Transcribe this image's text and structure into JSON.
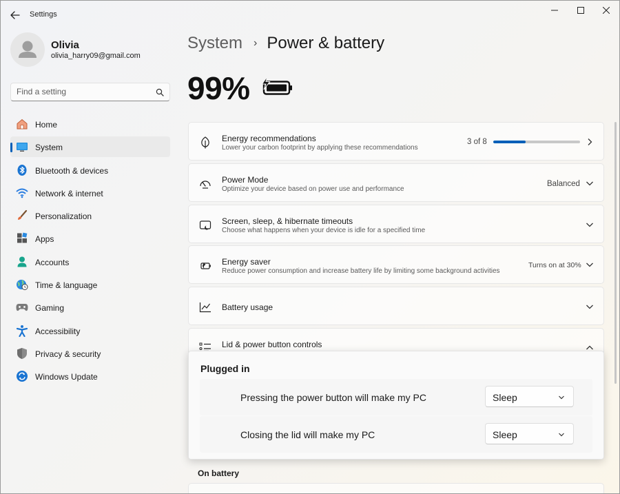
{
  "window": {
    "title": "Settings",
    "back_label": "←",
    "minimize_label": "—",
    "maximize_label": "☐",
    "close_label": "✕"
  },
  "profile": {
    "name": "Olivia",
    "email": "olivia_harry09@gmail.com"
  },
  "search": {
    "placeholder": "Find a setting",
    "value": ""
  },
  "sidebar": {
    "items": [
      {
        "label": "Home",
        "icon": "home-icon"
      },
      {
        "label": "System",
        "icon": "system-icon",
        "active": true
      },
      {
        "label": "Bluetooth & devices",
        "icon": "bluetooth-icon"
      },
      {
        "label": "Network & internet",
        "icon": "wifi-icon"
      },
      {
        "label": "Personalization",
        "icon": "brush-icon"
      },
      {
        "label": "Apps",
        "icon": "apps-icon"
      },
      {
        "label": "Accounts",
        "icon": "accounts-icon"
      },
      {
        "label": "Time & language",
        "icon": "globe-clock-icon"
      },
      {
        "label": "Gaming",
        "icon": "gamepad-icon"
      },
      {
        "label": "Accessibility",
        "icon": "accessibility-icon"
      },
      {
        "label": "Privacy & security",
        "icon": "shield-icon"
      },
      {
        "label": "Windows Update",
        "icon": "update-icon"
      }
    ]
  },
  "breadcrumb": {
    "parent": "System",
    "separator": "›",
    "current": "Power & battery"
  },
  "battery": {
    "percent_text": "99%",
    "level": 0.99,
    "charging": true
  },
  "cards": {
    "energy_recommendations": {
      "title": "Energy recommendations",
      "subtitle": "Lower your carbon footprint by applying these recommendations",
      "progress_text": "3 of 8",
      "progress_fraction": 0.375
    },
    "power_mode": {
      "title": "Power Mode",
      "subtitle": "Optimize your device based on power use and performance",
      "value": "Balanced"
    },
    "screen_sleep": {
      "title": "Screen, sleep, & hibernate timeouts",
      "subtitle": "Choose what happens when your device is idle for a specified time"
    },
    "energy_saver": {
      "title": "Energy saver",
      "subtitle": "Reduce power consumption and increase battery life by limiting some background activities",
      "value": "Turns on at 30%"
    },
    "battery_usage": {
      "title": "Battery usage"
    },
    "lid_power": {
      "title": "Lid & power button controls"
    }
  },
  "lid_panel": {
    "plugged_in_heading": "Plugged in",
    "rows": [
      {
        "label": "Pressing the power button will make my PC",
        "value": "Sleep"
      },
      {
        "label": "Closing the lid will make my PC",
        "value": "Sleep"
      }
    ],
    "on_battery_heading": "On battery"
  },
  "colors": {
    "accent": "#005fb8",
    "progress_track": "#c8c8c8"
  }
}
